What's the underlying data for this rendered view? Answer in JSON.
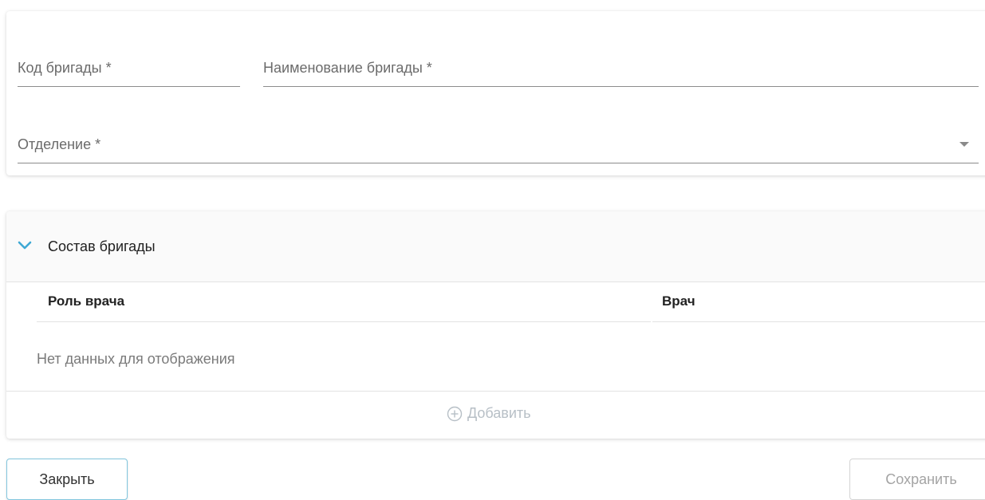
{
  "form": {
    "code_label": "Код бригады *",
    "name_label": "Наименование бригады *",
    "department_label": "Отделение *"
  },
  "team_panel": {
    "title": "Состав бригады",
    "columns": [
      "Роль врача",
      "Врач"
    ],
    "empty_text": "Нет данных для отображения",
    "add_label": "Добавить"
  },
  "actions": {
    "close_label": "Закрыть",
    "save_label": "Сохранить"
  },
  "colors": {
    "accent": "#3fa9d4",
    "close_border": "#82c6de",
    "disabled_text": "#a4a4a4"
  }
}
